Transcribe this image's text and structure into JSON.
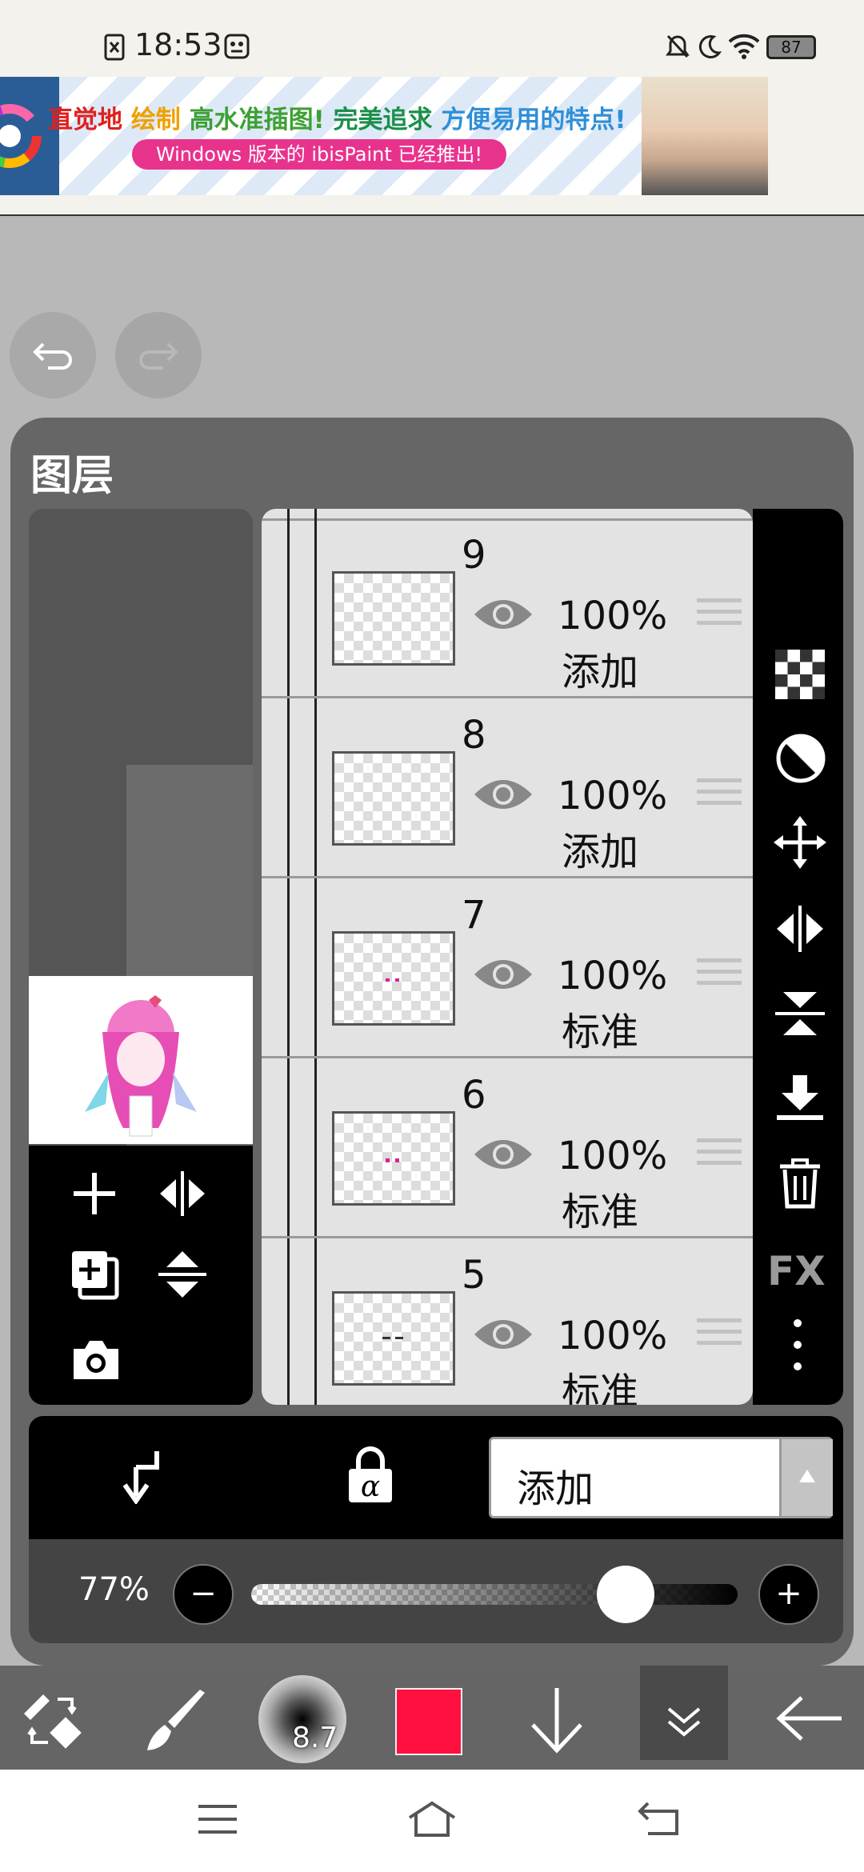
{
  "status_bar": {
    "time": "18:53",
    "battery": "87"
  },
  "ad": {
    "headline_parts": [
      {
        "text": "直觉地",
        "color": "#e0201e"
      },
      {
        "text": " 绘制 ",
        "color": "#f0a000"
      },
      {
        "text": "高水准插图!",
        "color": "#3da034"
      },
      {
        "text": " 完美追求 ",
        "color": "#1b8f4a"
      },
      {
        "text": "方便易用的特点!",
        "color": "#2e8fd8"
      }
    ],
    "subline": "Windows 版本的 ibisPaint 已经推出!"
  },
  "panel": {
    "title": "图层"
  },
  "layers": [
    {
      "number": "9",
      "opacity": "100%",
      "blend": "添加",
      "mark": ""
    },
    {
      "number": "8",
      "opacity": "100%",
      "blend": "添加",
      "mark": ""
    },
    {
      "number": "7",
      "opacity": "100%",
      "blend": "标准",
      "mark": "pink"
    },
    {
      "number": "6",
      "opacity": "100%",
      "blend": "标准",
      "mark": "pink"
    },
    {
      "number": "5",
      "opacity": "100%",
      "blend": "标准",
      "mark": "dark"
    }
  ],
  "side_tools": [
    "checker-icon",
    "invert-icon",
    "move-icon",
    "flip-horizontal-icon",
    "flip-vertical-icon",
    "merge-down-icon",
    "trash-icon",
    "FX",
    "more-icon"
  ],
  "blend_mode": {
    "selected": "添加"
  },
  "opacity": {
    "label": "77%",
    "value": 0.77
  },
  "brush": {
    "size": "8.7"
  },
  "colors": {
    "primary": "#ff1040",
    "panel": "#666666",
    "accent_pink": "#e8338d"
  }
}
